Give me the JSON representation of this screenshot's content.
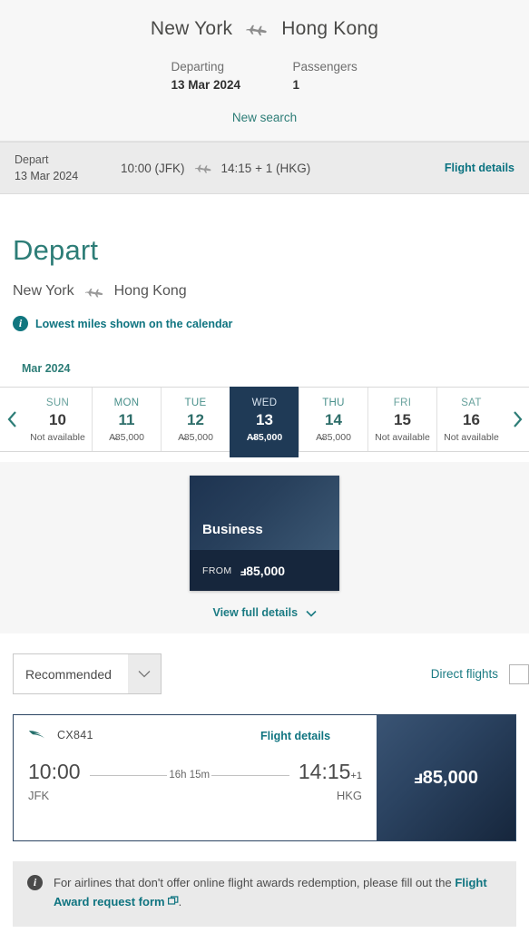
{
  "header": {
    "origin": "New York",
    "destination": "Hong Kong",
    "plane_icon": "plane-icon",
    "departing_label": "Departing",
    "departing_value": "13 Mar 2024",
    "passengers_label": "Passengers",
    "passengers_value": "1",
    "new_search": "New search"
  },
  "depart_strip": {
    "label": "Depart",
    "date": "13 Mar 2024",
    "dep_time": "10:00 (JFK)",
    "arr_time": "14:15 + 1 (HKG)",
    "details_link": "Flight details"
  },
  "depart_section": {
    "heading": "Depart",
    "origin": "New York",
    "destination": "Hong Kong",
    "info_icon": "info-icon",
    "lowest_miles_note": "Lowest miles shown on the calendar"
  },
  "calendar": {
    "month": "Mar 2024",
    "prev_icon": "chevron-left-icon",
    "next_icon": "chevron-right-icon",
    "days": [
      {
        "dow": "SUN",
        "num": "10",
        "price": "Not available",
        "available": false,
        "selected": false
      },
      {
        "dow": "MON",
        "num": "11",
        "price": "A̶",
        "price_text": "85,000",
        "available": true,
        "selected": false
      },
      {
        "dow": "TUE",
        "num": "12",
        "price_text": "85,000",
        "available": true,
        "selected": false
      },
      {
        "dow": "WED",
        "num": "13",
        "price_text": "85,000",
        "available": true,
        "selected": true
      },
      {
        "dow": "THU",
        "num": "14",
        "price_text": "85,000",
        "available": true,
        "selected": false
      },
      {
        "dow": "FRI",
        "num": "15",
        "price": "Not available",
        "available": false,
        "selected": false
      },
      {
        "dow": "SAT",
        "num": "16",
        "price": "Not available",
        "available": false,
        "selected": false
      }
    ]
  },
  "cabin": {
    "name": "Business",
    "from_label": "FROM",
    "price": "85,000",
    "miles_symbol": "A",
    "view_full_details": "View full details",
    "chevron_icon": "chevron-down-icon"
  },
  "filters": {
    "sort_value": "Recommended",
    "sort_chevron_icon": "chevron-down-icon",
    "direct_flights_label": "Direct flights",
    "direct_flights_checked": false
  },
  "result": {
    "airline_icon": "cathay-brushwing-icon",
    "flight_number": "CX841",
    "details_link": "Flight details",
    "dep_time": "10:00",
    "dep_code": "JFK",
    "duration": "16h 15m",
    "arr_time": "14:15",
    "arr_day_offset": "+1",
    "arr_code": "HKG",
    "price": "85,000",
    "miles_symbol": "A"
  },
  "notice": {
    "info_icon": "info-icon",
    "text": "For airlines that don't offer online flight awards redemption, please fill out the ",
    "link": "Flight Award request form",
    "external_icon": "external-link-icon",
    "period": "."
  },
  "colors": {
    "teal": "#2d7d77",
    "link_teal": "#0f7480",
    "navy": "#1f3a56",
    "dark_navy": "#16263c"
  }
}
